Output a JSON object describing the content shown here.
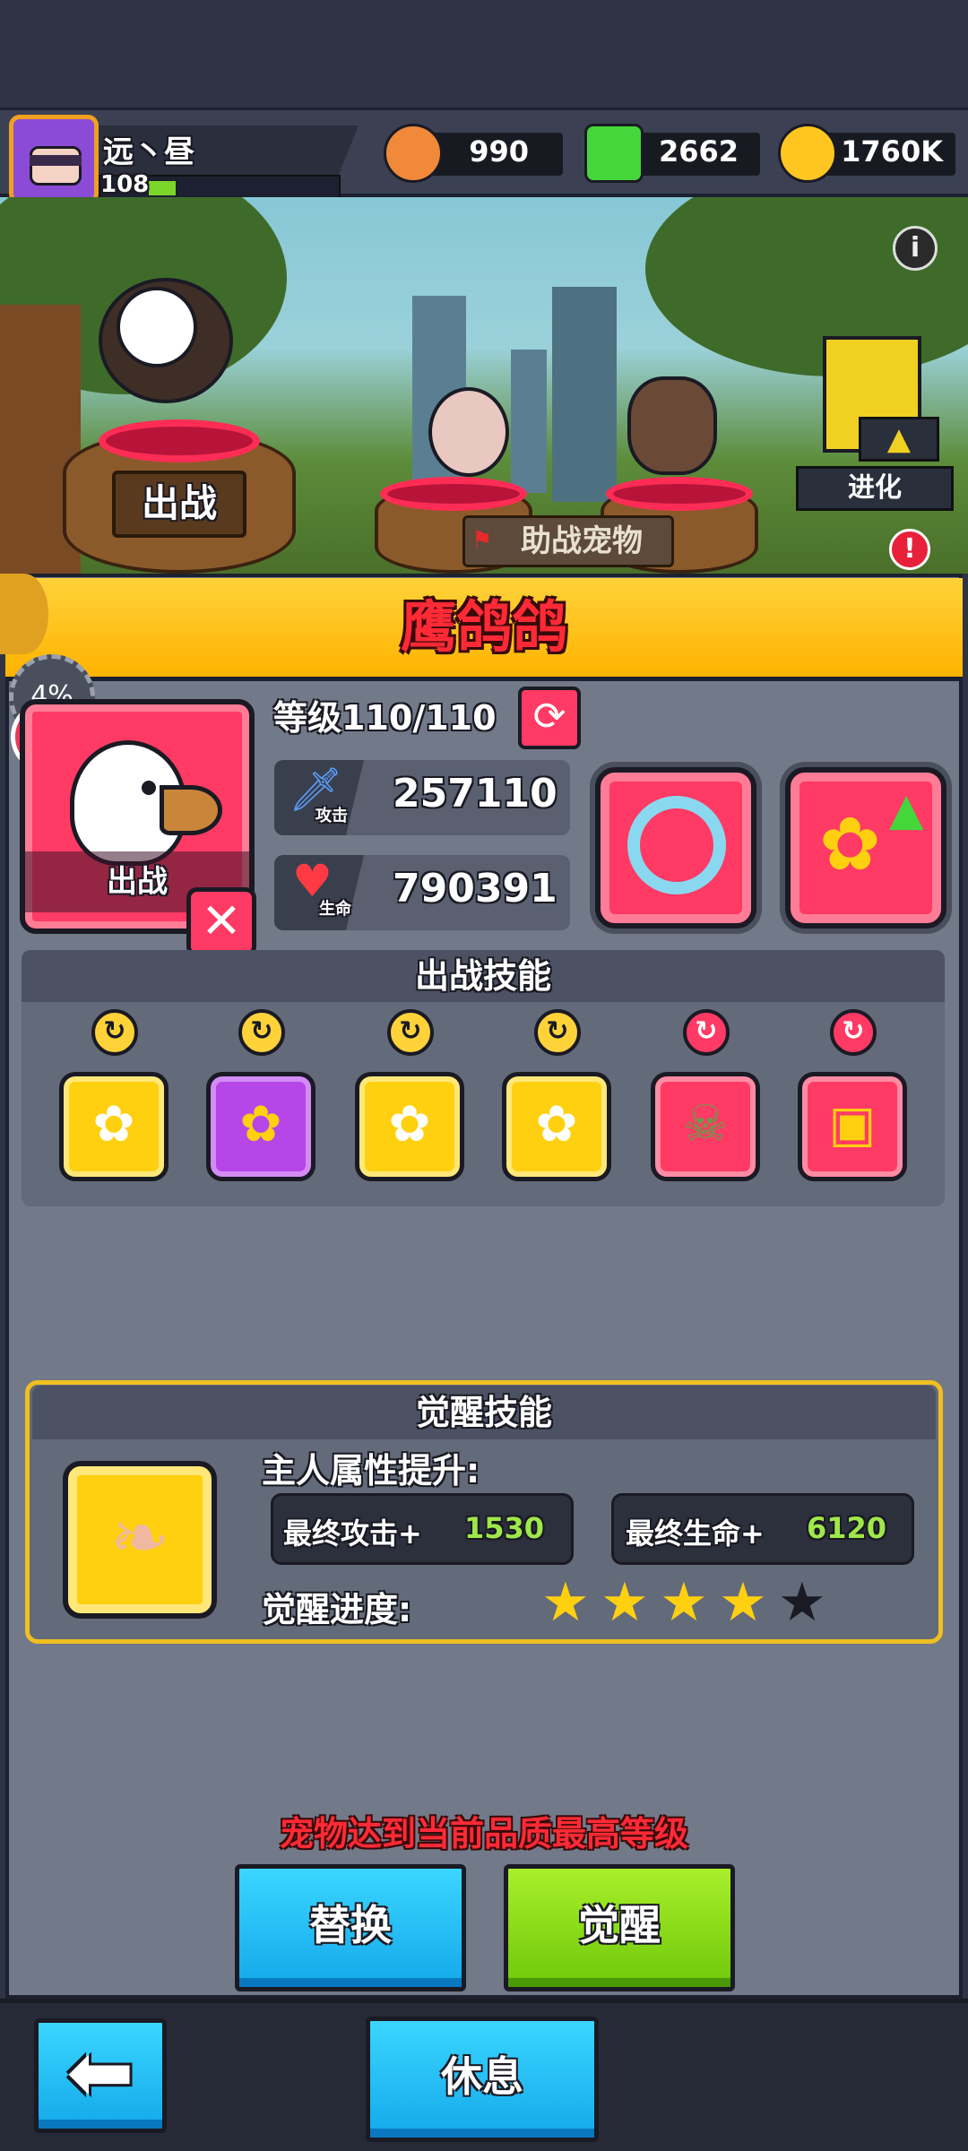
{
  "player": {
    "name": "远丶昼",
    "level": "108"
  },
  "currencies": [
    {
      "name": "paw-coin",
      "value": "990",
      "color": "#f08a3a"
    },
    {
      "name": "gem",
      "value": "2662",
      "color": "#44d63a"
    },
    {
      "name": "gold",
      "value": "1760K",
      "color": "#ffc520"
    }
  ],
  "scene": {
    "deploy_sign": "出战",
    "assist_sign": "助战宠物",
    "evolve_label": "进化",
    "info_icon": "i",
    "alert_icon": "!"
  },
  "pet": {
    "name": "鹰鸽鸽",
    "deploy_progress": "4%",
    "card_label": "出战",
    "level_text": "等级110/110",
    "attack_tag": "攻击",
    "attack": "257110",
    "hp_tag": "生命",
    "hp": "790391"
  },
  "skills": {
    "header": "出战技能",
    "items": [
      {
        "name": "paw-percent",
        "style": "yellow",
        "indicator": "gold"
      },
      {
        "name": "paw-purple",
        "style": "purple",
        "indicator": "gold"
      },
      {
        "name": "paw-up",
        "style": "yellow",
        "indicator": "gold"
      },
      {
        "name": "paw-heal",
        "style": "yellow",
        "indicator": "gold"
      },
      {
        "name": "zombie-paw",
        "style": "red",
        "indicator": "red"
      },
      {
        "name": "chest-up",
        "style": "red",
        "indicator": "red"
      }
    ]
  },
  "awaken": {
    "header": "觉醒技能",
    "attr_label": "主人属性提升:",
    "attack_label": "最终攻击+",
    "attack_value": "1530",
    "hp_label": "最终生命+",
    "hp_value": "6120",
    "progress_label": "觉醒进度:",
    "stars": {
      "filled": 4,
      "total": 5
    }
  },
  "footer": {
    "max_message": "宠物达到当前品质最高等级",
    "replace_label": "替换",
    "awaken_label": "觉醒",
    "rest_label": "休息"
  },
  "colors": {
    "accent_red": "#ff3a64",
    "title_yellow": "#ffc21a",
    "button_blue": "#14a8ea",
    "button_green": "#6fc80a"
  }
}
